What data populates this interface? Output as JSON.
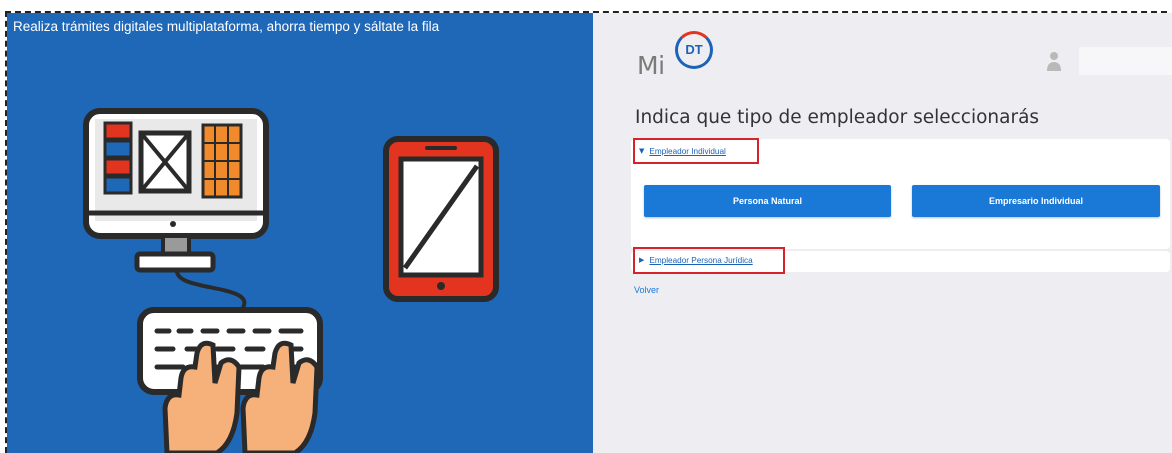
{
  "banner": {
    "tagline": "Realiza trámites digitales multiplataforma, ahorra tiempo y sáltate la fila"
  },
  "header": {
    "logo_prefix": "Mi",
    "logo_badge": "DT",
    "user_icon": "user-icon"
  },
  "main": {
    "heading": "Indica que tipo de empleador seleccionarás",
    "sections": [
      {
        "label": "Empleador Individual",
        "expanded": true,
        "options": [
          "Persona Natural",
          "Empresario Individual"
        ]
      },
      {
        "label": "Empleador Persona Jurídica",
        "expanded": false
      }
    ],
    "back_label": "Volver"
  },
  "colors": {
    "banner_bg": "#1f68b8",
    "accent_blue": "#1a78d6",
    "highlight_red": "#d8212a",
    "logo_red": "#e2341f"
  }
}
